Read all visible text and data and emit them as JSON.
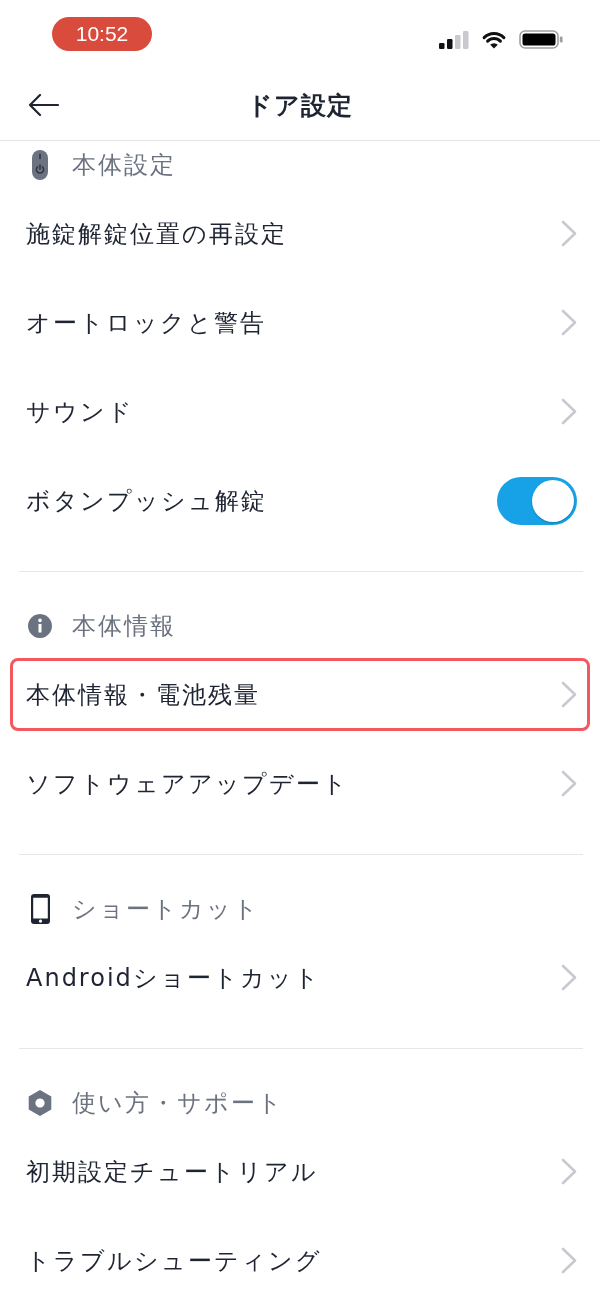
{
  "status_bar": {
    "time": "10:52"
  },
  "header": {
    "title": "ドア設定"
  },
  "sections": [
    {
      "title": "本体設定",
      "items": [
        {
          "label": "施錠解錠位置の再設定",
          "kind": "link",
          "highlighted": false
        },
        {
          "label": "オートロックと警告",
          "kind": "link",
          "highlighted": false
        },
        {
          "label": "サウンド",
          "kind": "link",
          "highlighted": false
        },
        {
          "label": "ボタンプッシュ解錠",
          "kind": "toggle",
          "on": true,
          "highlighted": false
        }
      ]
    },
    {
      "title": "本体情報",
      "items": [
        {
          "label": "本体情報・電池残量",
          "kind": "link",
          "highlighted": true
        },
        {
          "label": "ソフトウェアアップデート",
          "kind": "link",
          "highlighted": false
        }
      ]
    },
    {
      "title": "ショートカット",
      "items": [
        {
          "label": "Androidショートカット",
          "kind": "link",
          "highlighted": false
        }
      ]
    },
    {
      "title": "使い方・サポート",
      "items": [
        {
          "label": "初期設定チュートリアル",
          "kind": "link",
          "highlighted": false
        },
        {
          "label": "トラブルシューティング",
          "kind": "link",
          "highlighted": false
        }
      ]
    }
  ]
}
